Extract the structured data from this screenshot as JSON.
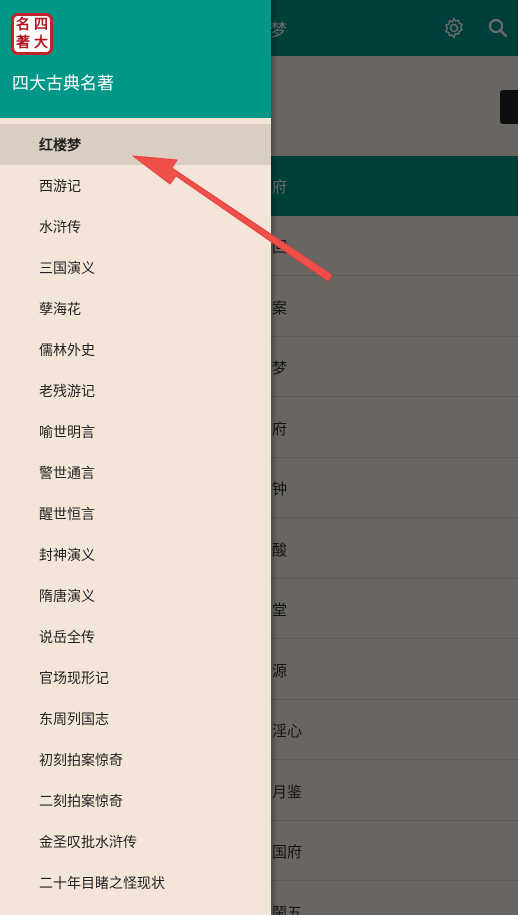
{
  "drawer": {
    "app_name": "四大古典名著",
    "logo_chars": [
      "名",
      "四",
      "著",
      "大"
    ],
    "selected_index": 0,
    "items": [
      "红楼梦",
      "西游记",
      "水浒传",
      "三国演义",
      "孽海花",
      "儒林外史",
      "老残游记",
      "喻世明言",
      "警世通言",
      "醒世恒言",
      "封神演义",
      "隋唐演义",
      "说岳全传",
      "官场现形记",
      "东周列国志",
      "初刻拍案惊奇",
      "二刻拍案惊奇",
      "金圣叹批水浒传",
      "二十年目睹之怪现状"
    ]
  },
  "toolbar": {
    "title": "梦",
    "icons": [
      "gear-icon",
      "search-icon"
    ]
  },
  "background": {
    "section_header": "府",
    "rows": [
      "回",
      "案",
      "梦",
      "府",
      "钟",
      "酸",
      "堂",
      "源",
      "淫心",
      "月鉴",
      "国府",
      "鬧五"
    ]
  },
  "colors": {
    "accent": "#009688",
    "drawer_bg": "#f3e6d9",
    "selected_bg": "#d9cec1",
    "arrow": "#f0504a",
    "logo_red": "#c0232b"
  }
}
